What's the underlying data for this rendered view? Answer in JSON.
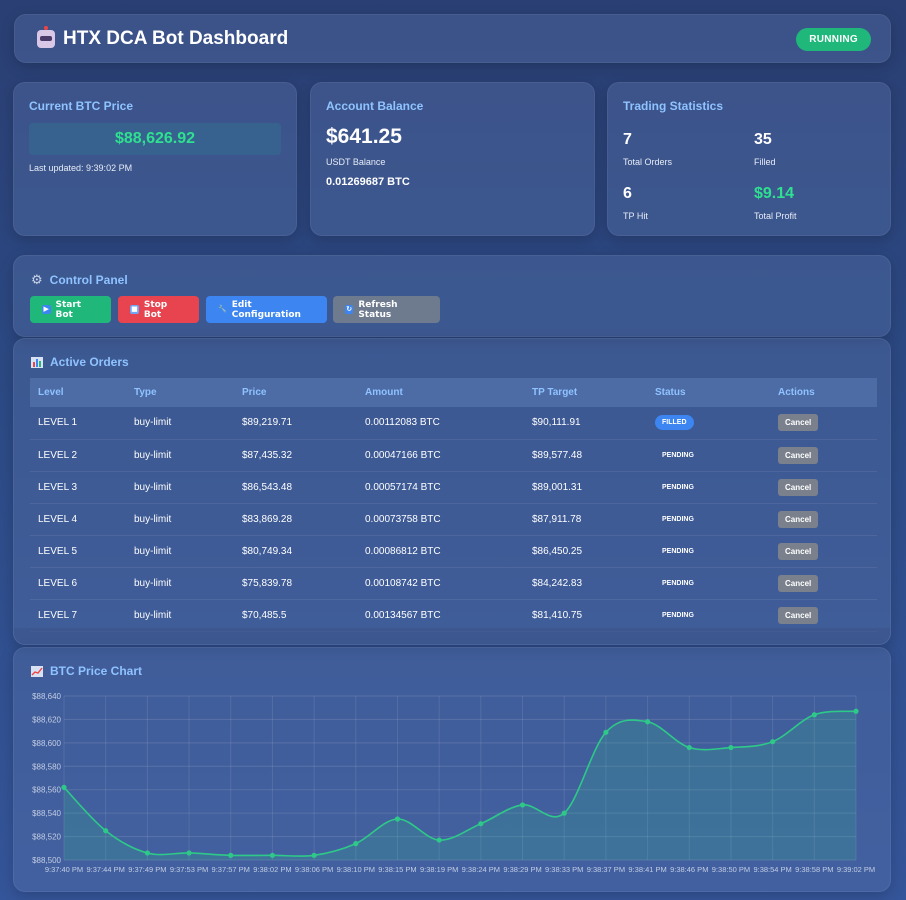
{
  "header": {
    "title": "HTX DCA Bot Dashboard",
    "status": "RUNNING"
  },
  "price_card": {
    "title": "Current BTC Price",
    "price": "$88,626.92",
    "updated": "Last updated: 9:39:02 PM"
  },
  "balance_card": {
    "title": "Account Balance",
    "usdt": "$641.25",
    "usdt_label": "USDT Balance",
    "btc": "0.01269687 BTC"
  },
  "stats_card": {
    "title": "Trading Statistics",
    "total_orders": "7",
    "total_orders_label": "Total Orders",
    "filled": "35",
    "filled_label": "Filled",
    "tp_hit": "6",
    "tp_hit_label": "TP Hit",
    "total_profit": "$9.14",
    "total_profit_label": "Total Profit"
  },
  "control_panel": {
    "title": "Control Panel",
    "start": "Start Bot",
    "stop": "Stop Bot",
    "edit": "Edit Configuration",
    "refresh": "Refresh Status"
  },
  "orders": {
    "title": "Active Orders",
    "columns": [
      "Level",
      "Type",
      "Price",
      "Amount",
      "TP Target",
      "Status",
      "Actions"
    ],
    "rows": [
      {
        "level": "LEVEL 1",
        "type": "buy-limit",
        "price": "$89,219.71",
        "amount": "0.00112083 BTC",
        "tp": "$90,111.91",
        "status": "FILLED",
        "action": "Cancel"
      },
      {
        "level": "LEVEL 2",
        "type": "buy-limit",
        "price": "$87,435.32",
        "amount": "0.00047166 BTC",
        "tp": "$89,577.48",
        "status": "PENDING",
        "action": "Cancel"
      },
      {
        "level": "LEVEL 3",
        "type": "buy-limit",
        "price": "$86,543.48",
        "amount": "0.00057174 BTC",
        "tp": "$89,001.31",
        "status": "PENDING",
        "action": "Cancel"
      },
      {
        "level": "LEVEL 4",
        "type": "buy-limit",
        "price": "$83,869.28",
        "amount": "0.00073758 BTC",
        "tp": "$87,911.78",
        "status": "PENDING",
        "action": "Cancel"
      },
      {
        "level": "LEVEL 5",
        "type": "buy-limit",
        "price": "$80,749.34",
        "amount": "0.00086812 BTC",
        "tp": "$86,450.25",
        "status": "PENDING",
        "action": "Cancel"
      },
      {
        "level": "LEVEL 6",
        "type": "buy-limit",
        "price": "$75,839.78",
        "amount": "0.00108742 BTC",
        "tp": "$84,242.83",
        "status": "PENDING",
        "action": "Cancel"
      },
      {
        "level": "LEVEL 7",
        "type": "buy-limit",
        "price": "$70,485.5",
        "amount": "0.00134567 BTC",
        "tp": "$81,410.75",
        "status": "PENDING",
        "action": "Cancel"
      }
    ]
  },
  "chart_title": "BTC Price Chart",
  "chart_data": {
    "type": "area",
    "title": "",
    "xlabel": "",
    "ylabel": "",
    "ylim": [
      88500,
      88640
    ],
    "yticks": [
      "$88,500",
      "$88,520",
      "$88,540",
      "$88,560",
      "$88,580",
      "$88,600",
      "$88,620",
      "$88,640"
    ],
    "ytick_values": [
      88500,
      88520,
      88540,
      88560,
      88580,
      88600,
      88620,
      88640
    ],
    "x": [
      "9:37:40 PM",
      "9:37:44 PM",
      "9:37:49 PM",
      "9:37:53 PM",
      "9:37:57 PM",
      "9:38:02 PM",
      "9:38:06 PM",
      "9:38:10 PM",
      "9:38:15 PM",
      "9:38:19 PM",
      "9:38:24 PM",
      "9:38:29 PM",
      "9:38:33 PM",
      "9:38:37 PM",
      "9:38:41 PM",
      "9:38:46 PM",
      "9:38:50 PM",
      "9:38:54 PM",
      "9:38:58 PM",
      "9:39:02 PM"
    ],
    "series": [
      {
        "values": [
          88562,
          88525,
          88506,
          88506,
          88504,
          88504,
          88504,
          88514,
          88535,
          88517,
          88531,
          88547,
          88540,
          88609,
          88618,
          88596,
          88596,
          88601,
          88624,
          88627
        ]
      }
    ],
    "grid": true,
    "color": "#2ec988"
  }
}
